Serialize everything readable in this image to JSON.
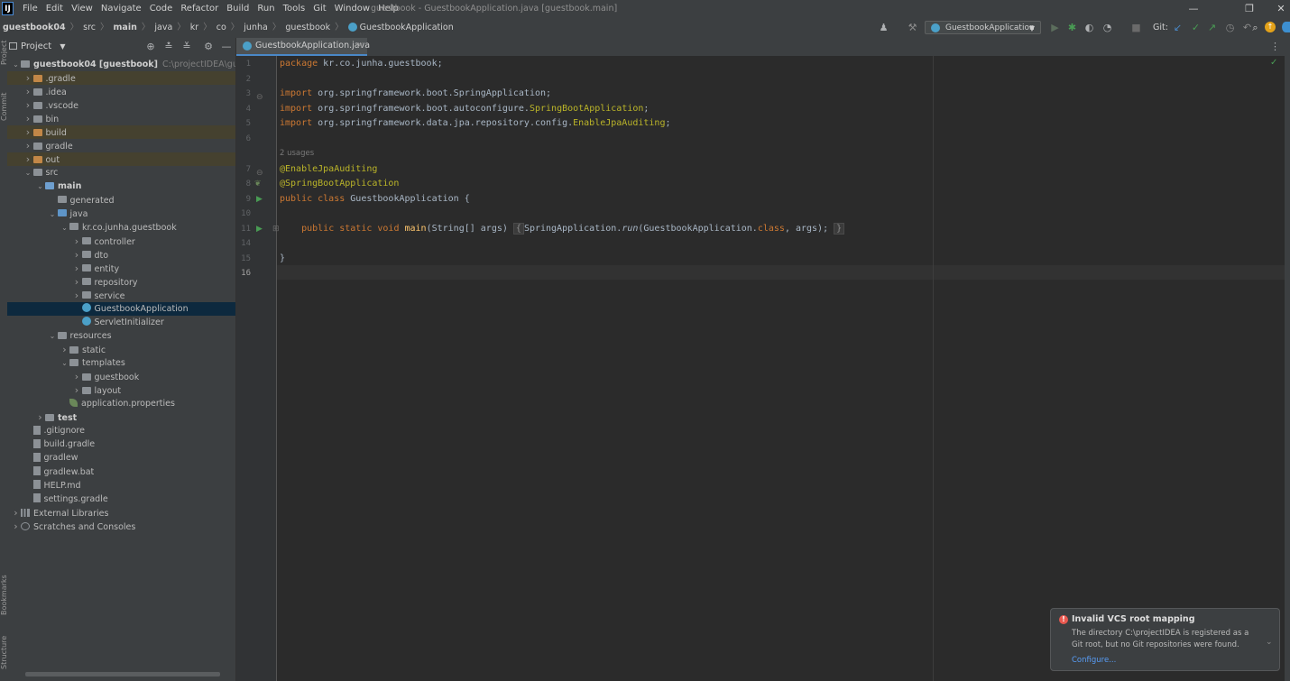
{
  "menu": [
    "File",
    "Edit",
    "View",
    "Navigate",
    "Code",
    "Refactor",
    "Build",
    "Run",
    "Tools",
    "Git",
    "Window",
    "Help"
  ],
  "window_title": "guestbook - GuestbookApplication.java [guestbook.main]",
  "breadcrumbs": [
    "guestbook04",
    "src",
    "main",
    "java",
    "kr",
    "co",
    "junha",
    "guestbook",
    "GuestbookApplication"
  ],
  "run_config": "GuestbookApplication",
  "git_label": "Git:",
  "project_panel": {
    "title": "Project",
    "tree": [
      {
        "label": "guestbook04 [guestbook]",
        "extra": "C:\\projectIDEA\\guestboo",
        "indent": 0,
        "arrow": "down",
        "icon": "folder",
        "bold": true
      },
      {
        "label": ".gradle",
        "indent": 1,
        "arrow": "right",
        "icon": "folder-orange",
        "hl": true
      },
      {
        "label": ".idea",
        "indent": 1,
        "arrow": "right",
        "icon": "folder"
      },
      {
        "label": ".vscode",
        "indent": 1,
        "arrow": "right",
        "icon": "folder"
      },
      {
        "label": "bin",
        "indent": 1,
        "arrow": "right",
        "icon": "folder"
      },
      {
        "label": "build",
        "indent": 1,
        "arrow": "right",
        "icon": "folder-orange",
        "hl": true
      },
      {
        "label": "gradle",
        "indent": 1,
        "arrow": "right",
        "icon": "folder"
      },
      {
        "label": "out",
        "indent": 1,
        "arrow": "right",
        "icon": "folder-orange",
        "hl": true
      },
      {
        "label": "src",
        "indent": 1,
        "arrow": "down",
        "icon": "folder"
      },
      {
        "label": "main",
        "indent": 2,
        "arrow": "down",
        "icon": "folder-blue",
        "bold": true
      },
      {
        "label": "generated",
        "indent": 3,
        "arrow": "",
        "icon": "folder"
      },
      {
        "label": "java",
        "indent": 3,
        "arrow": "down",
        "icon": "folder-src"
      },
      {
        "label": "kr.co.junha.guestbook",
        "indent": 4,
        "arrow": "down",
        "icon": "folder"
      },
      {
        "label": "controller",
        "indent": 5,
        "arrow": "right",
        "icon": "folder"
      },
      {
        "label": "dto",
        "indent": 5,
        "arrow": "right",
        "icon": "folder"
      },
      {
        "label": "entity",
        "indent": 5,
        "arrow": "right",
        "icon": "folder"
      },
      {
        "label": "repository",
        "indent": 5,
        "arrow": "right",
        "icon": "folder"
      },
      {
        "label": "service",
        "indent": 5,
        "arrow": "right",
        "icon": "folder"
      },
      {
        "label": "GuestbookApplication",
        "indent": 5,
        "arrow": "",
        "icon": "class",
        "sel": true
      },
      {
        "label": "ServletInitializer",
        "indent": 5,
        "arrow": "",
        "icon": "class"
      },
      {
        "label": "resources",
        "indent": 3,
        "arrow": "down",
        "icon": "folder"
      },
      {
        "label": "static",
        "indent": 4,
        "arrow": "right",
        "icon": "folder"
      },
      {
        "label": "templates",
        "indent": 4,
        "arrow": "down",
        "icon": "folder"
      },
      {
        "label": "guestbook",
        "indent": 5,
        "arrow": "right",
        "icon": "folder"
      },
      {
        "label": "layout",
        "indent": 5,
        "arrow": "right",
        "icon": "folder"
      },
      {
        "label": "application.properties",
        "indent": 4,
        "arrow": "",
        "icon": "leaf"
      },
      {
        "label": "test",
        "indent": 2,
        "arrow": "right",
        "icon": "folder",
        "bold": true
      },
      {
        "label": ".gitignore",
        "indent": 1,
        "arrow": "",
        "icon": "file"
      },
      {
        "label": "build.gradle",
        "indent": 1,
        "arrow": "",
        "icon": "file"
      },
      {
        "label": "gradlew",
        "indent": 1,
        "arrow": "",
        "icon": "file"
      },
      {
        "label": "gradlew.bat",
        "indent": 1,
        "arrow": "",
        "icon": "file"
      },
      {
        "label": "HELP.md",
        "indent": 1,
        "arrow": "",
        "icon": "file"
      },
      {
        "label": "settings.gradle",
        "indent": 1,
        "arrow": "",
        "icon": "file"
      },
      {
        "label": "External Libraries",
        "indent": 0,
        "arrow": "right",
        "icon": "lib"
      },
      {
        "label": "Scratches and Consoles",
        "indent": 0,
        "arrow": "right",
        "icon": "scratch"
      }
    ]
  },
  "editor": {
    "tab": "GuestbookApplication.java",
    "usages": "2 usages",
    "lines": [
      {
        "num": "1",
        "code": [
          [
            "kw",
            "package "
          ],
          [
            "",
            "kr.co.junha.guestbook;"
          ]
        ]
      },
      {
        "num": "2",
        "code": []
      },
      {
        "num": "3",
        "code": [
          [
            "kw",
            "import "
          ],
          [
            "",
            "org.springframework.boot.SpringApplication;"
          ]
        ]
      },
      {
        "num": "4",
        "code": [
          [
            "kw",
            "import "
          ],
          [
            "",
            "org.springframework.boot.autoconfigure."
          ],
          [
            "ann",
            "SpringBootApplication"
          ],
          [
            "",
            ";"
          ]
        ]
      },
      {
        "num": "5",
        "code": [
          [
            "kw",
            "import "
          ],
          [
            "",
            "org.springframework.data.jpa.repository.config."
          ],
          [
            "ann",
            "EnableJpaAuditing"
          ],
          [
            "",
            ";"
          ]
        ]
      },
      {
        "num": "6",
        "code": []
      },
      {
        "num": "7",
        "code": [
          [
            "ann",
            "@EnableJpaAuditing"
          ]
        ]
      },
      {
        "num": "8",
        "code": [
          [
            "ann",
            "@SpringBootApplication"
          ]
        ]
      },
      {
        "num": "9",
        "code": [
          [
            "kw",
            "public class "
          ],
          [
            "",
            "GuestbookApplication {"
          ]
        ]
      },
      {
        "num": "10",
        "code": []
      },
      {
        "num": "11",
        "code": [
          [
            "",
            "    "
          ],
          [
            "kw",
            "public static void "
          ],
          [
            "fn",
            "main"
          ],
          [
            "",
            "(String[] args) "
          ],
          [
            "fold",
            "{"
          ],
          [
            "",
            ""
          ],
          [
            "",
            ""
          ],
          [
            "",
            "SpringApplication."
          ],
          [
            "it",
            "run"
          ],
          [
            "",
            "(GuestbookApplication."
          ],
          [
            "kw",
            "class"
          ],
          [
            "",
            ", args); "
          ],
          [
            "fold",
            "}"
          ]
        ]
      },
      {
        "num": "14",
        "code": []
      },
      {
        "num": "15",
        "code": [
          [
            "",
            "}"
          ]
        ]
      },
      {
        "num": "16",
        "code": []
      }
    ]
  },
  "notification": {
    "title": "Invalid VCS root mapping",
    "body": "The directory C:\\projectIDEA is registered as a Git root, but no Git repositories were found.",
    "link": "Configure..."
  },
  "side_labels": {
    "project": "Project",
    "commit": "Commit",
    "bookmarks": "Bookmarks",
    "structure": "Structure"
  }
}
